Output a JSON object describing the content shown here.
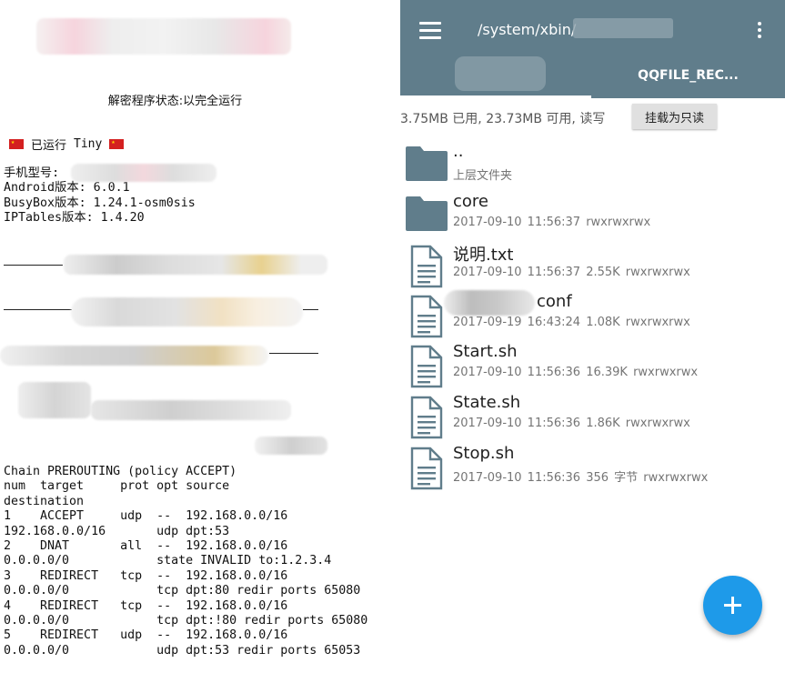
{
  "left": {
    "status_line": "解密程序状态:以完全运行",
    "run_status": "已运行",
    "run_mode": "Tiny",
    "info_lines": [
      "手机型号:",
      "Android版本: 6.0.1",
      "BusyBox版本: 1.24.1-osm0sis",
      "IPTables版本: 1.4.20"
    ],
    "iptables_text": "Chain PREROUTING (policy ACCEPT)\nnum  target     prot opt source\ndestination\n1    ACCEPT     udp  --  192.168.0.0/16\n192.168.0.0/16       udp dpt:53\n2    DNAT       all  --  192.168.0.0/16\n0.0.0.0/0            state INVALID to:1.2.3.4\n3    REDIRECT   tcp  --  192.168.0.0/16\n0.0.0.0/0            tcp dpt:80 redir ports 65080\n4    REDIRECT   tcp  --  192.168.0.0/16\n0.0.0.0/0            tcp dpt:!80 redir ports 65080\n5    REDIRECT   udp  --  192.168.0.0/16\n0.0.0.0/0            udp dpt:53 redir ports 65053"
  },
  "right": {
    "appbar": {
      "path": "/system/xbin/",
      "menu_icon": "hamburger-menu-icon",
      "more_icon": "more-vert-icon",
      "tab2_label": "QQFILE_REC...",
      "color": "#607d8b"
    },
    "storage_text": "3.75MB 已用, 23.73MB 可用, 读写",
    "mount_button": "挂载为只读",
    "files": [
      {
        "name": "..",
        "meta": "上层文件夹",
        "icon": "folder-icon"
      },
      {
        "name": "core",
        "meta": "2017-09-10 11:56:37   rwxrwxrwx",
        "icon": "folder-icon"
      },
      {
        "name": "说明.txt",
        "meta": "2017-09-10 11:56:37 2.55K rwxrwxrwx",
        "icon": "document-icon"
      },
      {
        "name": "conf",
        "meta": "2017-09-19 16:43:24 1.08K rwxrwxrwx",
        "icon": "document-icon"
      },
      {
        "name": "Start.sh",
        "meta": "2017-09-10 11:56:36 16.39K rwxrwxrwx",
        "icon": "document-icon"
      },
      {
        "name": "State.sh",
        "meta": "2017-09-10 11:56:36 1.86K rwxrwxrwx",
        "icon": "document-icon"
      },
      {
        "name": "Stop.sh",
        "meta": "2017-09-10 11:56:36 356 字节 rwxrwxrwx",
        "icon": "document-icon"
      }
    ],
    "fab_icon": "add-icon",
    "fab_color": "#1e9ae9"
  }
}
